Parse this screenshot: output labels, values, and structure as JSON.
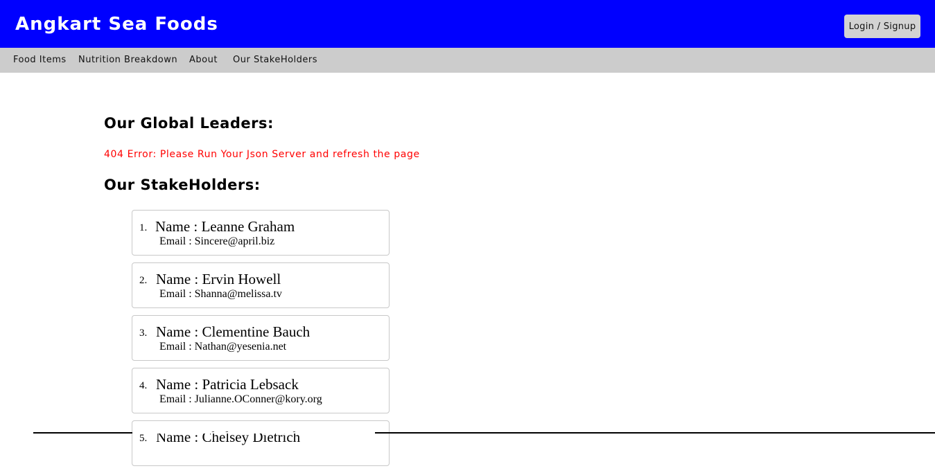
{
  "header": {
    "brand": "Angkart Sea Foods",
    "login_label": "Login / Signup"
  },
  "nav": {
    "items": [
      {
        "label": "Food Items"
      },
      {
        "label": "Nutrition Breakdown"
      },
      {
        "label": "About"
      },
      {
        "label": "Our StakeHolders"
      }
    ]
  },
  "main": {
    "leaders_title": "Our Global Leaders:",
    "error_message": "404 Error: Please Run Your Json Server and refresh the page",
    "stakeholders_title": "Our StakeHolders:",
    "stakeholders": [
      {
        "num": "1.",
        "name": "Name : Leanne Graham",
        "email": "Email : Sincere@april.biz"
      },
      {
        "num": "2.",
        "name": "Name : Ervin Howell",
        "email": "Email : Shanna@melissa.tv"
      },
      {
        "num": "3.",
        "name": "Name : Clementine Bauch",
        "email": "Email : Nathan@yesenia.net"
      },
      {
        "num": "4.",
        "name": "Name : Patricia Lebsack",
        "email": "Email : Julianne.OConner@kory.org"
      },
      {
        "num": "5.",
        "name": "Name : Chelsey Dietrich",
        "email": ""
      }
    ]
  },
  "colors": {
    "header_bg": "#0000ff",
    "subnav_bg": "#cccccc",
    "error_text": "#ff0000",
    "button_bg": "#d3d3d3"
  }
}
